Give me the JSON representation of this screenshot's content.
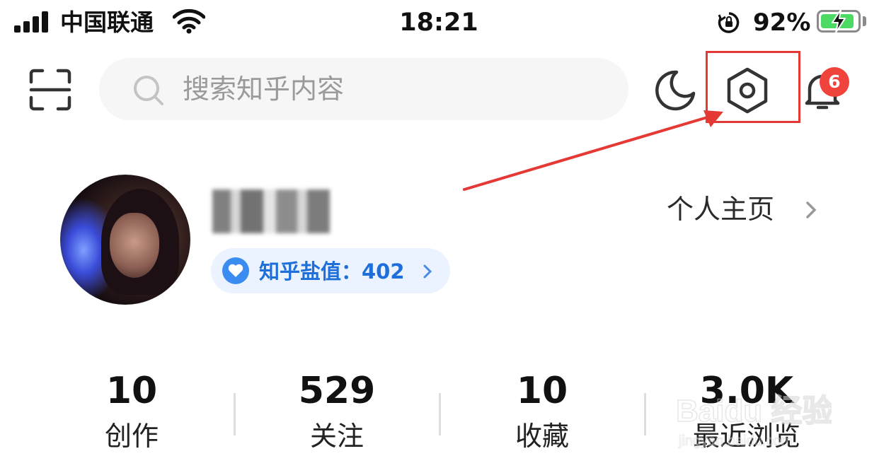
{
  "status_bar": {
    "carrier": "中国联通",
    "time": "18:21",
    "battery_percent": "92%",
    "battery_level": 0.92
  },
  "toolbar": {
    "search_placeholder": "搜索知乎内容",
    "notification_count": "6",
    "highlight_color": "#e53935"
  },
  "profile": {
    "salt_value_label": "知乎盐值：402",
    "homepage_link": "个人主页"
  },
  "stats": [
    {
      "value": "10",
      "label": "创作"
    },
    {
      "value": "529",
      "label": "关注"
    },
    {
      "value": "10",
      "label": "收藏"
    },
    {
      "value": "3.0K",
      "label": "最近浏览"
    }
  ],
  "watermark": {
    "text": "Baidu 经验",
    "subtext": "jingyan.baidu.com"
  },
  "icons": {
    "scan": "scan-icon",
    "search": "search-icon",
    "night_mode": "moon-icon",
    "settings": "settings-icon",
    "notifications": "bell-icon"
  },
  "colors": {
    "accent_blue": "#1e6fd9",
    "badge_red": "#f0433b",
    "annotation_red": "#e53935"
  }
}
